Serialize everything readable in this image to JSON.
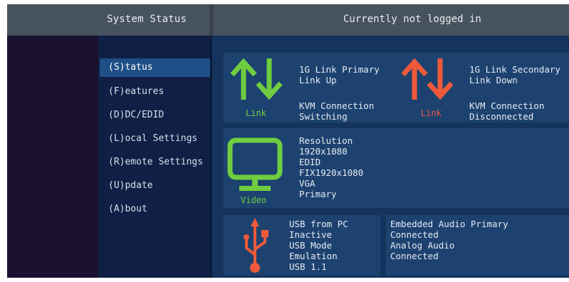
{
  "header": {
    "title": "System Status",
    "login_status": "Currently not logged in"
  },
  "menu": {
    "items": [
      {
        "label": "(S)tatus",
        "active": true
      },
      {
        "label": "(F)eatures",
        "active": false
      },
      {
        "label": "(D)DC/EDID",
        "active": false
      },
      {
        "label": "(L)ocal Settings",
        "active": false
      },
      {
        "label": "(R)emote Settings",
        "active": false
      },
      {
        "label": "(U)pdate",
        "active": false
      },
      {
        "label": "(A)bout",
        "active": false
      }
    ]
  },
  "link_primary": {
    "icon_label": "Link",
    "color": "#6fcd3f",
    "line1": "1G Link Primary",
    "line2": "Link Up",
    "kvm_line1": "KVM Connection",
    "kvm_line2": "Switching"
  },
  "link_secondary": {
    "icon_label": "Link",
    "color": "#ee5a3a",
    "line1": "1G Link Secondary",
    "line2": "Link Down",
    "kvm_line1": "KVM Connection",
    "kvm_line2": "Disconnected"
  },
  "video": {
    "icon_label": "Video",
    "color": "#6fcd3f",
    "lines": [
      "Resolution",
      "1920x1080",
      "EDID",
      "FIX1920x1080",
      "VGA",
      "Primary"
    ]
  },
  "usb": {
    "color": "#ee5a3a",
    "lines": [
      "USB from PC",
      "Inactive",
      "USB Mode",
      "Emulation",
      "USB 1.1"
    ]
  },
  "audio": {
    "lines": [
      "Embedded Audio Primary",
      "Connected",
      "Analog Audio",
      "Connected"
    ]
  }
}
